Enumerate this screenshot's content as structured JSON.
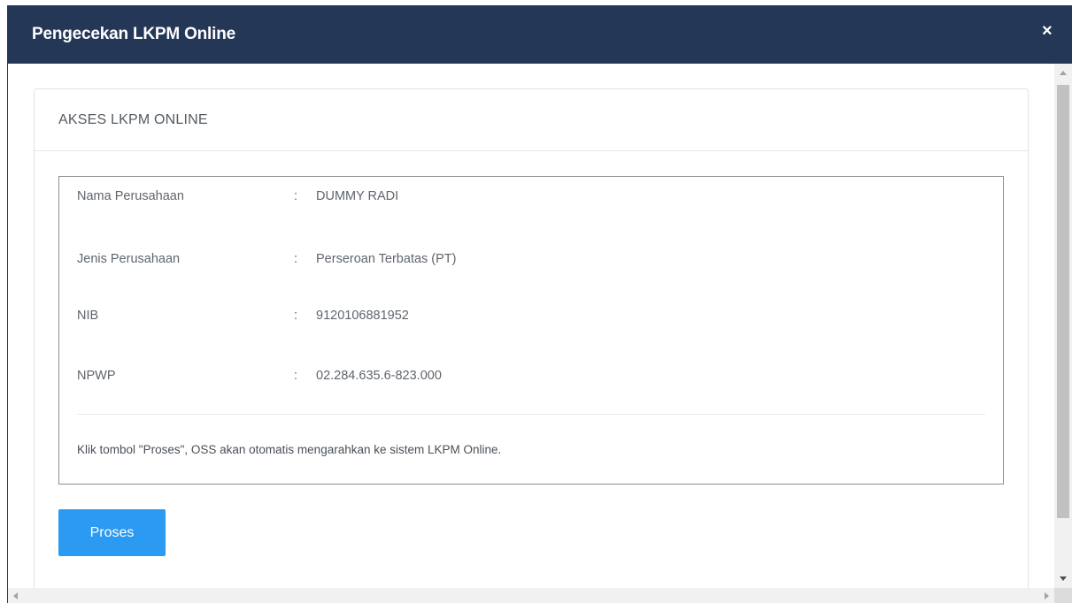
{
  "modal": {
    "title": "Pengecekan LKPM Online",
    "close_label": "×"
  },
  "panel": {
    "title": "AKSES LKPM ONLINE",
    "rows": [
      {
        "label": "Nama Perusahaan",
        "colon": ":",
        "value": "DUMMY RADI"
      },
      {
        "label": "Jenis Perusahaan",
        "colon": ":",
        "value": "Perseroan Terbatas (PT)"
      },
      {
        "label": "NIB",
        "colon": ":",
        "value": "9120106881952"
      },
      {
        "label": "NPWP",
        "colon": ":",
        "value": "02.284.635.6-823.000"
      }
    ],
    "note": "Klik tombol \"Proses\", OSS akan otomatis mengarahkan ke sistem LKPM Online.",
    "button_label": "Proses"
  },
  "colors": {
    "header_bg": "#243757",
    "button_bg": "#2b9af3"
  }
}
